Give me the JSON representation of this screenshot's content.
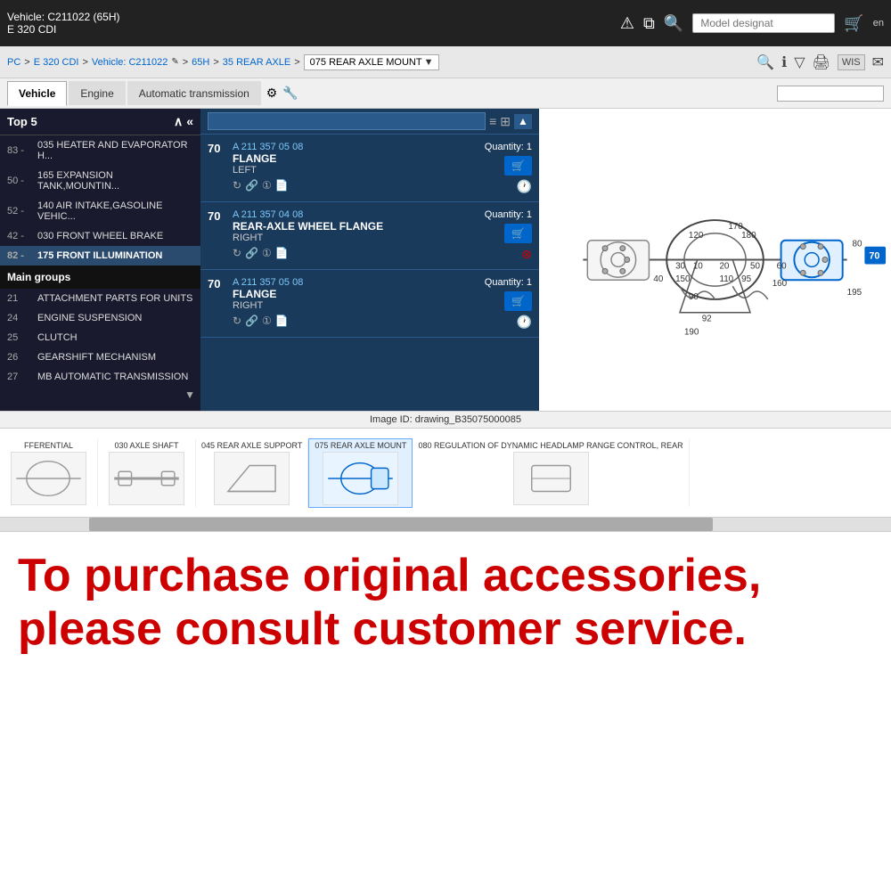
{
  "topbar": {
    "vehicle_id": "Vehicle: C211022 (65H)",
    "vehicle_name": "E 320 CDI",
    "search_placeholder": "Model designat",
    "lang": "en",
    "warning_icon": "⚠",
    "copy_icon": "⧉",
    "search_icon": "🔍",
    "cart_icon": "🛒"
  },
  "breadcrumb": {
    "items": [
      "PC",
      "E 320 CDI",
      "Vehicle: C211022",
      "65H",
      "35 REAR AXLE",
      "075 REAR AXLE MOUNT"
    ],
    "separator": ">"
  },
  "tabs": {
    "items": [
      "Vehicle",
      "Engine",
      "Automatic transmission"
    ],
    "active": "Vehicle",
    "search_placeholder": ""
  },
  "sidebar": {
    "header": "Top 5",
    "items": [
      {
        "num": "83 -",
        "label": "035 HEATER AND EVAPORATOR H..."
      },
      {
        "num": "50 -",
        "label": "165 EXPANSION TANK,MOUNTIN..."
      },
      {
        "num": "52 -",
        "label": "140 AIR INTAKE,GASOLINE VEHIC..."
      },
      {
        "num": "42 -",
        "label": "030 FRONT WHEEL BRAKE"
      },
      {
        "num": "82 -",
        "label": "175 FRONT ILLUMINATION"
      }
    ],
    "section": "Main groups",
    "main_groups": [
      {
        "num": "21",
        "label": "ATTACHMENT PARTS FOR UNITS"
      },
      {
        "num": "24",
        "label": "ENGINE SUSPENSION"
      },
      {
        "num": "25",
        "label": "CLUTCH"
      },
      {
        "num": "26",
        "label": "GEARSHIFT MECHANISM"
      },
      {
        "num": "27",
        "label": "MB AUTOMATIC TRANSMISSION"
      }
    ]
  },
  "parts": {
    "items": [
      {
        "pos": "70",
        "number": "A 211 357 05 08",
        "name": "FLANGE",
        "detail": "LEFT",
        "quantity": "Quantity: 1"
      },
      {
        "pos": "70",
        "number": "A 211 357 04 08",
        "name": "REAR-AXLE WHEEL FLANGE",
        "detail": "RIGHT",
        "quantity": "Quantity: 1"
      },
      {
        "pos": "70",
        "number": "A 211 357 05 08",
        "name": "FLANGE",
        "detail": "RIGHT",
        "quantity": "Quantity: 1"
      }
    ]
  },
  "diagram": {
    "image_id": "Image ID: drawing_B35075000085",
    "highlight_label": "70"
  },
  "thumbnails": [
    {
      "label": "FFERENTIAL",
      "active": false
    },
    {
      "label": "030 AXLE SHAFT",
      "active": false
    },
    {
      "label": "045 REAR AXLE SUPPORT",
      "active": false
    },
    {
      "label": "075 REAR AXLE MOUNT",
      "active": true
    },
    {
      "label": "080 REGULATION OF DYNAMIC HEADLAMP RANGE CONTROL, REAR",
      "active": false
    }
  ],
  "advertisement": {
    "line1": "To purchase original accessories,",
    "line2": "please consult customer service."
  }
}
